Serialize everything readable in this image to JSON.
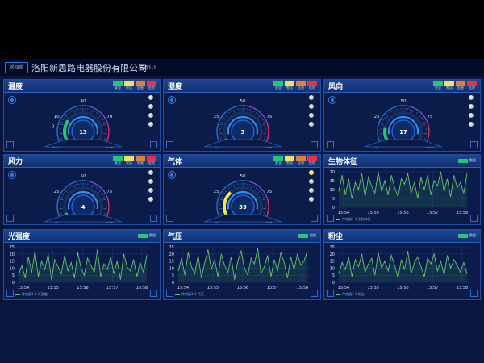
{
  "header": {
    "back_label": "返回首",
    "company": "洛阳新思路电器股份有限公司",
    "node": "节点1-1"
  },
  "legend": [
    {
      "label": "安全",
      "color": "#22c878"
    },
    {
      "label": "警告",
      "color": "#f2e15a"
    },
    {
      "label": "危害",
      "color": "#f07a30"
    },
    {
      "label": "危险",
      "color": "#e8304a"
    }
  ],
  "colors": {
    "fill": "#1e7fd8",
    "panel_bg": "#0b1b4a",
    "line": "#66c46e",
    "green": "#22c878",
    "yellow": "#f2e15a",
    "red": "#e8304a"
  },
  "gauges": [
    {
      "id": "temp",
      "title": "温度",
      "min": -20,
      "max": 100,
      "value": 13,
      "ticks": [
        "-20",
        "-10",
        "0",
        "10",
        "20",
        "30",
        "40",
        "50",
        "60",
        "70",
        "80",
        "90",
        "100"
      ],
      "major": [
        "-20",
        "0",
        "10",
        "40",
        "70",
        "100"
      ],
      "bar_color": "#22c878",
      "lit": []
    },
    {
      "id": "humid",
      "title": "湿度",
      "min": 0,
      "max": 100,
      "value": 3,
      "ticks": [
        "0",
        "25",
        "50",
        "75",
        "100"
      ],
      "major": [
        "0",
        "25",
        "50",
        "75",
        "100"
      ],
      "bar_color": "#22c878",
      "lit": []
    },
    {
      "id": "wind_dir",
      "title": "风向",
      "min": 0,
      "max": 100,
      "value": 17,
      "ticks": [
        "0",
        "25",
        "50",
        "75",
        "100"
      ],
      "major": [
        "0",
        "25",
        "50",
        "75",
        "100"
      ],
      "bar_color": "#22c878",
      "lit": []
    },
    {
      "id": "wind_force",
      "title": "风力",
      "min": 0,
      "max": 100,
      "value": 4,
      "ticks": [
        "0",
        "25",
        "50",
        "75",
        "100"
      ],
      "major": [
        "0",
        "25",
        "50",
        "75",
        "100"
      ],
      "bar_color": "#22c878",
      "lit": []
    },
    {
      "id": "gas",
      "title": "气体",
      "min": 0,
      "max": 100,
      "value": 33,
      "ticks": [
        "0",
        "25",
        "50",
        "75",
        "100"
      ],
      "major": [
        "0",
        "25",
        "50",
        "75",
        "100"
      ],
      "bar_color": "#f2e15a",
      "lit": [
        0
      ]
    }
  ],
  "status_label": "数据",
  "chart_data": [
    {
      "type": "line",
      "title": "生物体征",
      "series_label": "传感器1-1 生物体征",
      "x_ticks": [
        "15:54",
        "15:55",
        "15:56",
        "15:57",
        "15:58"
      ],
      "ylim": [
        0,
        20
      ],
      "y_ticks": [
        "0",
        "5",
        "10",
        "15",
        "20"
      ],
      "values": [
        9,
        18,
        7,
        16,
        5,
        14,
        10,
        19,
        6,
        17,
        12,
        8,
        20,
        9,
        15,
        7,
        18,
        11,
        6,
        16,
        13,
        19,
        8,
        14,
        5,
        17,
        10,
        18,
        7,
        15,
        12,
        20,
        9,
        16,
        6,
        18,
        11,
        14,
        8,
        19
      ]
    },
    {
      "type": "line",
      "title": "光强度",
      "series_label": "传感器1-1 光强度",
      "x_ticks": [
        "15:54",
        "15:55",
        "15:56",
        "15:57",
        "15:58"
      ],
      "ylim": [
        0,
        25
      ],
      "y_ticks": [
        "0",
        "5",
        "10",
        "15",
        "20",
        "25"
      ],
      "values": [
        5,
        12,
        3,
        18,
        7,
        22,
        4,
        15,
        9,
        20,
        2,
        16,
        11,
        6,
        19,
        8,
        14,
        3,
        21,
        10,
        5,
        17,
        12,
        7,
        23,
        4,
        13,
        9,
        18,
        6,
        15,
        2,
        20,
        11,
        8,
        16,
        4,
        14,
        7,
        19
      ]
    },
    {
      "type": "line",
      "title": "气压",
      "series_label": "传感器1-1 气压",
      "x_ticks": [
        "15:54",
        "15:55",
        "15:56",
        "15:57",
        "15:58"
      ],
      "ylim": [
        0,
        25
      ],
      "y_ticks": [
        "0",
        "5",
        "10",
        "15",
        "20",
        "25"
      ],
      "values": [
        8,
        17,
        5,
        21,
        11,
        6,
        19,
        3,
        14,
        23,
        9,
        16,
        4,
        20,
        12,
        7,
        18,
        2,
        15,
        22,
        10,
        5,
        17,
        13,
        24,
        6,
        11,
        19,
        4,
        16,
        8,
        21,
        14,
        3,
        18,
        9,
        20,
        12,
        15,
        22
      ]
    },
    {
      "type": "line",
      "title": "粉尘",
      "series_label": "传感器1-1 粉尘",
      "x_ticks": [
        "15:54",
        "15:55",
        "15:56",
        "15:57",
        "15:58"
      ],
      "ylim": [
        0,
        25
      ],
      "y_ticks": [
        "0",
        "5",
        "10",
        "15",
        "20",
        "25"
      ],
      "values": [
        6,
        14,
        9,
        18,
        4,
        16,
        11,
        20,
        7,
        13,
        17,
        5,
        21,
        10,
        15,
        8,
        19,
        12,
        3,
        16,
        9,
        22,
        6,
        14,
        18,
        11,
        4,
        17,
        13,
        20,
        8,
        15,
        5,
        19,
        10,
        16,
        12,
        7,
        14,
        6
      ]
    }
  ]
}
